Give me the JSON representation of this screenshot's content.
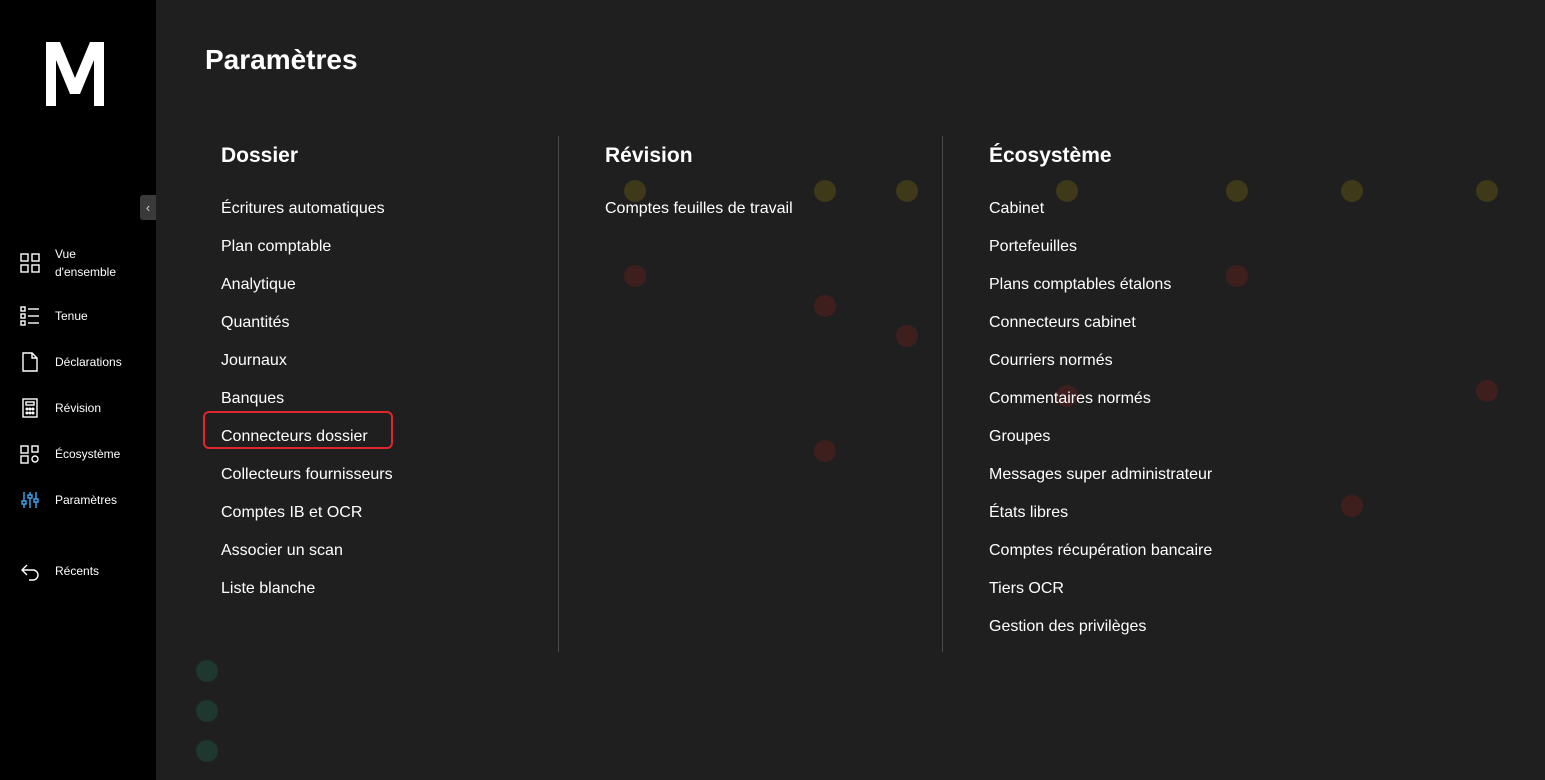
{
  "sidebar": {
    "logo_letter": "M",
    "items": [
      {
        "label": "Vue d'ensemble",
        "icon": "dashboard-grid-icon"
      },
      {
        "label": "Tenue",
        "icon": "list-icon"
      },
      {
        "label": "Déclarations",
        "icon": "document-icon"
      },
      {
        "label": "Révision",
        "icon": "calculator-icon"
      },
      {
        "label": "Écosystème",
        "icon": "ecosystem-icon"
      },
      {
        "label": "Paramètres",
        "icon": "sliders-icon",
        "active": true
      },
      {
        "label": "Récents",
        "icon": "back-arrow-icon"
      }
    ],
    "accent": "#3fa9f5"
  },
  "page": {
    "title": "Paramètres"
  },
  "menu": {
    "dossier": {
      "heading": "Dossier",
      "links": [
        "Écritures automatiques",
        "Plan comptable",
        "Analytique",
        "Quantités",
        "Journaux",
        "Banques",
        "Connecteurs dossier",
        "Collecteurs fournisseurs",
        "Comptes IB et OCR",
        "Associer un scan",
        "Liste blanche"
      ],
      "highlighted": "Connecteurs dossier"
    },
    "revision": {
      "heading": "Révision",
      "links": [
        "Comptes feuilles de travail"
      ]
    },
    "ecosysteme": {
      "heading": "Écosystème",
      "links": [
        "Cabinet",
        "Portefeuilles",
        "Plans comptables étalons",
        "Connecteurs cabinet",
        "Courriers normés",
        "Commentaires normés",
        "Groupes",
        "Messages super administrateur",
        "États libres",
        "Comptes récupération bancaire",
        "Tiers OCR",
        "Gestion des privilèges"
      ]
    }
  },
  "colors": {
    "highlight_border": "#e0262b",
    "overlay_bg": "#1f1f1f"
  }
}
